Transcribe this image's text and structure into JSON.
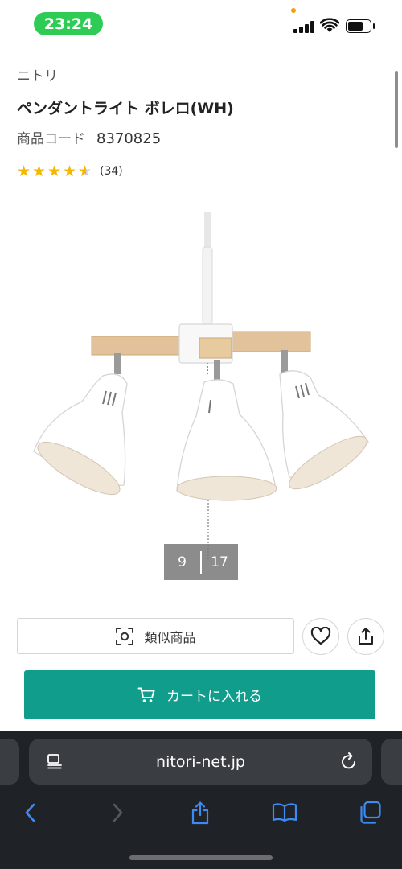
{
  "status_bar": {
    "time": "23:24"
  },
  "product": {
    "brand": "ニトリ",
    "name": "ペンダントライト ボレロ(WH)",
    "code_label": "商品コード",
    "code": "8370825",
    "rating": 4.5,
    "review_count": "(34)"
  },
  "gallery": {
    "current": "9",
    "total": "17"
  },
  "actions": {
    "similar_label": "類似商品",
    "favorite_icon": "heart-icon",
    "share_icon": "share-icon",
    "cart_label": "カートに入れる"
  },
  "browser": {
    "url": "nitori-net.jp",
    "toolbar_icons": [
      "back-icon",
      "forward-icon",
      "share-icon",
      "bookmarks-icon",
      "tabs-icon"
    ]
  },
  "colors": {
    "time_pill": "#2ecc55",
    "cart_button": "#119d8c",
    "star": "#f5b800",
    "browser_accent": "#3d8bf2",
    "browser_background": "#1f2226"
  }
}
